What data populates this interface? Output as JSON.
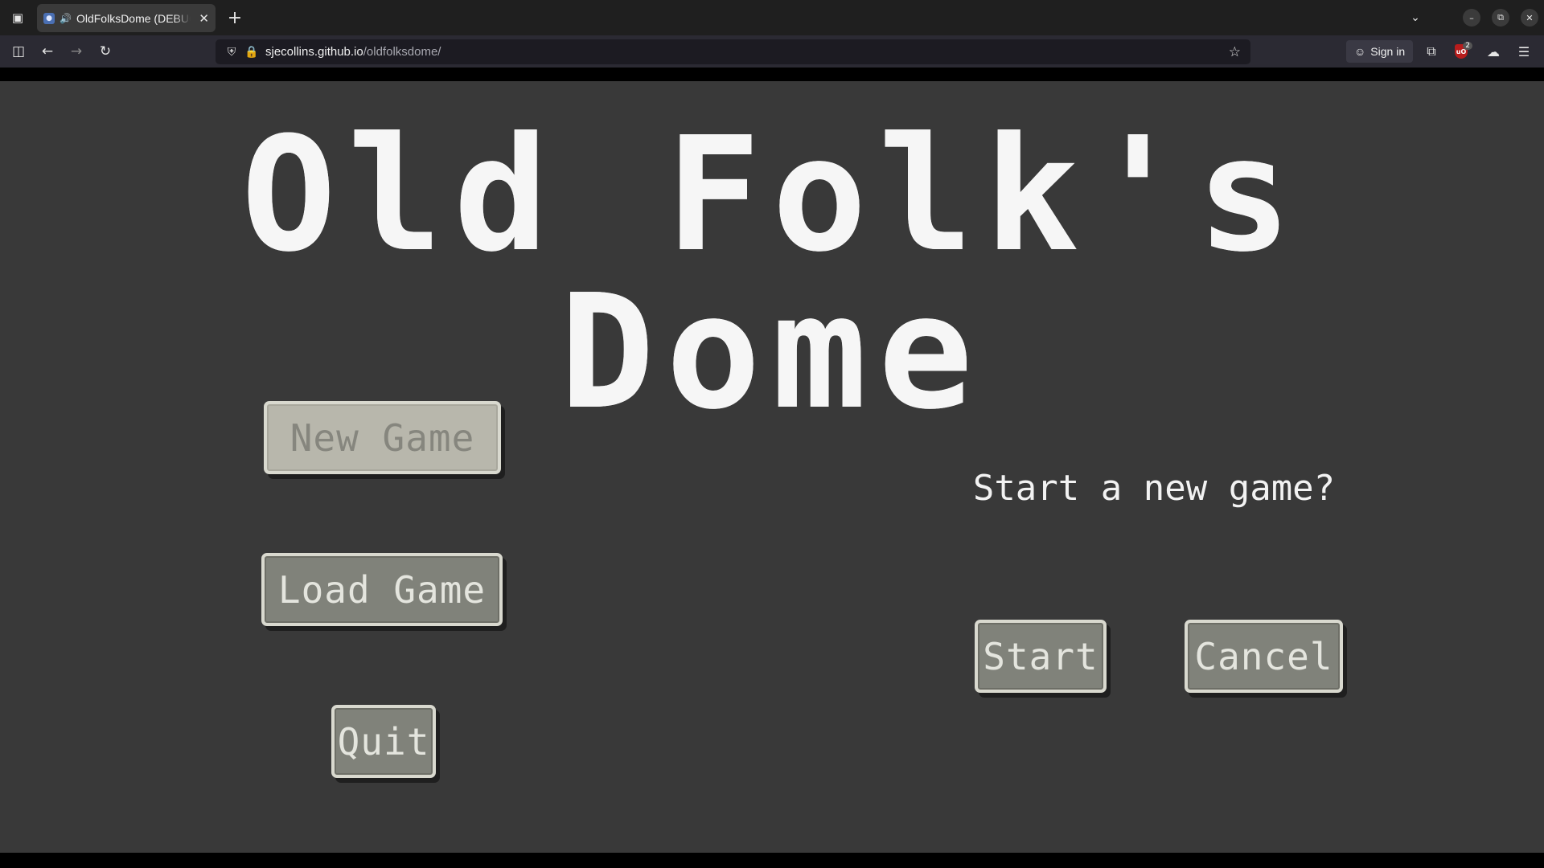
{
  "browser": {
    "tab_title": "OldFolksDome (DEBUG)",
    "url_host": "sjecollins.github.io",
    "url_path": "/oldfolksdome/",
    "signin_label": "Sign in",
    "extension_badge": "2"
  },
  "game": {
    "title": "Old Folk's Dome",
    "menu": {
      "new_game": "New Game",
      "load_game": "Load Game",
      "quit": "Quit"
    },
    "dialog": {
      "prompt": "Start a new game?",
      "start": "Start",
      "cancel": "Cancel"
    }
  },
  "colors": {
    "game_background": "#393939",
    "button_fill": "#80827a",
    "button_border": "#d9d9cf",
    "button_disabled_fill": "#b8b7ac",
    "title_text": "#f6f6f6"
  }
}
